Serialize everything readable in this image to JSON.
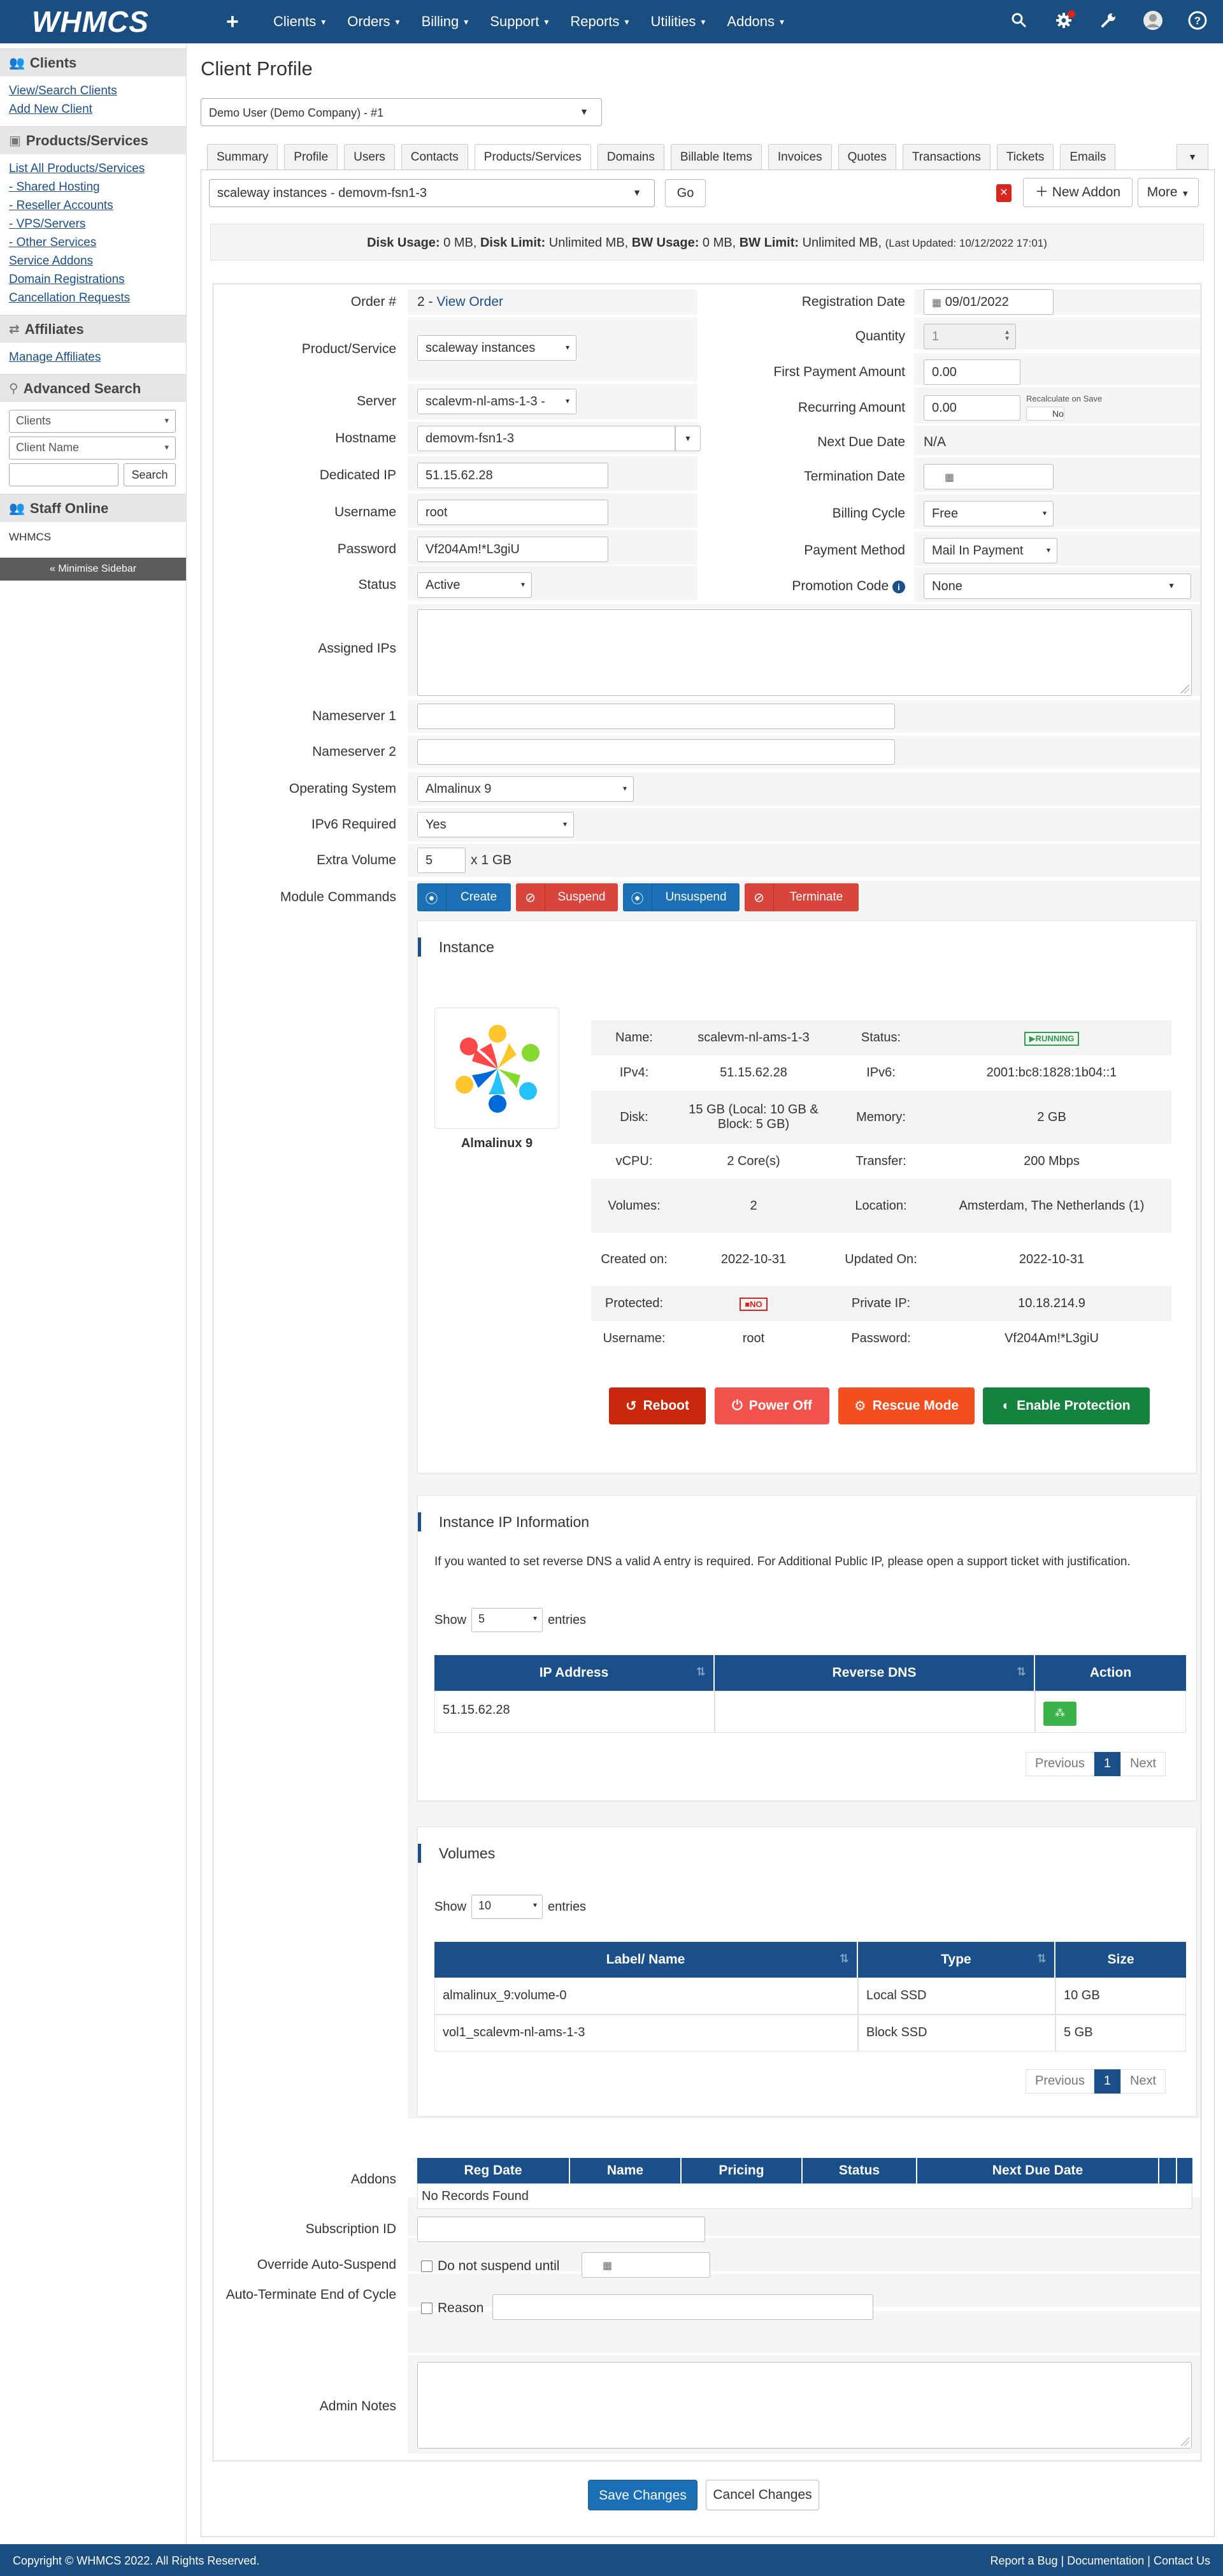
{
  "topnav": {
    "logo": "WHMCS",
    "plus": "+",
    "items": [
      {
        "label": "Clients"
      },
      {
        "label": "Orders"
      },
      {
        "label": "Billing"
      },
      {
        "label": "Support"
      },
      {
        "label": "Reports"
      },
      {
        "label": "Utilities"
      },
      {
        "label": "Addons"
      }
    ],
    "icons": [
      "search-icon",
      "gear-alert-icon",
      "wrench-icon",
      "user-icon",
      "help-icon"
    ]
  },
  "sidebar": {
    "clients": {
      "heading": "Clients",
      "links": [
        "View/Search Clients",
        "Add New Client"
      ]
    },
    "products": {
      "heading": "Products/Services",
      "links": [
        "List All Products/Services",
        "- Shared Hosting",
        "- Reseller Accounts",
        "- VPS/Servers",
        "- Other Services",
        "Service Addons",
        "Domain Registrations",
        "Cancellation Requests"
      ]
    },
    "affiliates": {
      "heading": "Affiliates",
      "links": [
        "Manage Affiliates"
      ]
    },
    "advanced_search": {
      "heading": "Advanced Search",
      "select1": "Clients",
      "select2": "Client Name",
      "button": "Search"
    },
    "staff": {
      "heading": "Staff Online",
      "name": "WHMCS"
    },
    "minimise": "« Minimise Sidebar"
  },
  "page": {
    "title": "Client Profile",
    "client_select": "Demo User (Demo Company) - #1",
    "tabs": [
      "Summary",
      "Profile",
      "Users",
      "Contacts",
      "Products/Services",
      "Domains",
      "Billable Items",
      "Invoices",
      "Quotes",
      "Transactions",
      "Tickets",
      "Emails"
    ],
    "active_tab": "Products/Services",
    "service_select": "scaleway instances - demovm-fsn1-3",
    "go": "Go",
    "new_addon": "New Addon",
    "more": "More",
    "disk": {
      "l1": "Disk Usage:",
      "v1": " 0 MB, ",
      "l2": "Disk Limit:",
      "v2": " Unlimited MB, ",
      "l3": "BW Usage:",
      "v3": " 0 MB, ",
      "l4": "BW Limit:",
      "v4": " Unlimited MB, ",
      "updated": "(Last Updated: 10/12/2022 17:01)"
    }
  },
  "form": {
    "order_label": "Order #",
    "order_num": "2 - ",
    "order_link": "View Order",
    "product_label": "Product/Service",
    "product_value": "scaleway instances",
    "server_label": "Server",
    "server_value": "scalevm-nl-ams-1-3 -",
    "hostname_label": "Hostname",
    "hostname_value": "demovm-fsn1-3",
    "dedicated_ip_label": "Dedicated IP",
    "dedicated_ip_value": "51.15.62.28",
    "username_label": "Username",
    "username_value": "root",
    "password_label": "Password",
    "password_value": "Vf204Am!*L3giU",
    "status_label": "Status",
    "status_value": "Active",
    "reg_date_label": "Registration Date",
    "reg_date_value": "09/01/2022",
    "quantity_label": "Quantity",
    "quantity_value": "1",
    "first_payment_label": "First Payment Amount",
    "first_payment_value": "0.00",
    "recurring_label": "Recurring Amount",
    "recurring_value": "0.00",
    "recalc_label": "Recalculate on Save",
    "recalc_value": "No",
    "next_due_label": "Next Due Date",
    "next_due_value": "N/A",
    "termination_label": "Termination Date",
    "billing_cycle_label": "Billing Cycle",
    "billing_cycle_value": "Free",
    "payment_method_label": "Payment Method",
    "payment_method_value": "Mail In Payment",
    "promotion_label": "Promotion Code",
    "promotion_value": "None",
    "assigned_ips_label": "Assigned IPs",
    "ns1_label": "Nameserver 1",
    "ns2_label": "Nameserver 2",
    "os_label": "Operating System",
    "os_value": "Almalinux 9",
    "ipv6_label": "IPv6 Required",
    "ipv6_value": "Yes",
    "extra_volume_label": "Extra Volume",
    "extra_volume_value": "5",
    "extra_volume_unit": "x 1 GB",
    "module_label": "Module Commands",
    "module_buttons": [
      "Create",
      "Suspend",
      "Unsuspend",
      "Terminate"
    ],
    "addons_label": "Addons",
    "addons_cols": [
      "Reg Date",
      "Name",
      "Pricing",
      "Status",
      "Next Due Date"
    ],
    "addons_empty": "No Records Found",
    "subscription_label": "Subscription ID",
    "override_label": "Override Auto-Suspend",
    "override_check": "Do not suspend until",
    "autoterm_label": "Auto-Terminate End of Cycle",
    "autoterm_check": "Reason",
    "admin_notes_label": "Admin Notes",
    "save": "Save Changes",
    "cancel": "Cancel Changes"
  },
  "instance": {
    "title": "Instance",
    "os_name": "Almalinux 9",
    "rows": [
      {
        "k1": "Name:",
        "v1": "scalevm-nl-ams-1-3",
        "k2": "Status:",
        "v2": "RUNNING"
      },
      {
        "k1": "IPv4:",
        "v1": "51.15.62.28",
        "k2": "IPv6:",
        "v2": "2001:bc8:1828:1b04::1"
      },
      {
        "k1": "Disk:",
        "v1": "15 GB (Local: 10 GB & Block: 5 GB)",
        "k2": "Memory:",
        "v2": "2 GB"
      },
      {
        "k1": "vCPU:",
        "v1": "2 Core(s)",
        "k2": "Transfer:",
        "v2": "200 Mbps"
      },
      {
        "k1": "Volumes:",
        "v1": "2",
        "k2": "Location:",
        "v2": "Amsterdam, The Netherlands (1)"
      },
      {
        "k1": "Created on:",
        "v1": "2022-10-31",
        "k2": "Updated On:",
        "v2": "2022-10-31"
      },
      {
        "k1": "Protected:",
        "v1": "NO",
        "k2": "Private IP:",
        "v2": "10.18.214.9"
      },
      {
        "k1": "Username:",
        "v1": "root",
        "k2": "Password:",
        "v2": "Vf204Am!*L3giU"
      }
    ],
    "buttons": [
      "Reboot",
      "Power Off",
      "Rescue Mode",
      "Enable Protection"
    ]
  },
  "ipinfo": {
    "title": "Instance IP Information",
    "note": "If you wanted to set reverse DNS a valid A entry is required. For Additional Public IP, please open a support ticket with justification.",
    "show": "Show",
    "show_value": "5",
    "entries": "entries",
    "cols": [
      "IP Address",
      "Reverse DNS",
      "Action"
    ],
    "rows": [
      {
        "ip": "51.15.62.28",
        "rdns": ""
      }
    ],
    "prev": "Previous",
    "page": "1",
    "next": "Next"
  },
  "volumes": {
    "title": "Volumes",
    "show": "Show",
    "show_value": "10",
    "entries": "entries",
    "cols": [
      "Label/ Name",
      "Type",
      "Size"
    ],
    "rows": [
      {
        "name": "almalinux_9:volume-0",
        "type": "Local SSD",
        "size": "10 GB"
      },
      {
        "name": "vol1_scalevm-nl-ams-1-3",
        "type": "Block SSD",
        "size": "5 GB"
      }
    ],
    "prev": "Previous",
    "page": "1",
    "next": "Next"
  },
  "footer": {
    "copyright": "Copyright © WHMCS 2022. All Rights Reserved.",
    "links": "Report a Bug | Documentation | Contact Us"
  }
}
